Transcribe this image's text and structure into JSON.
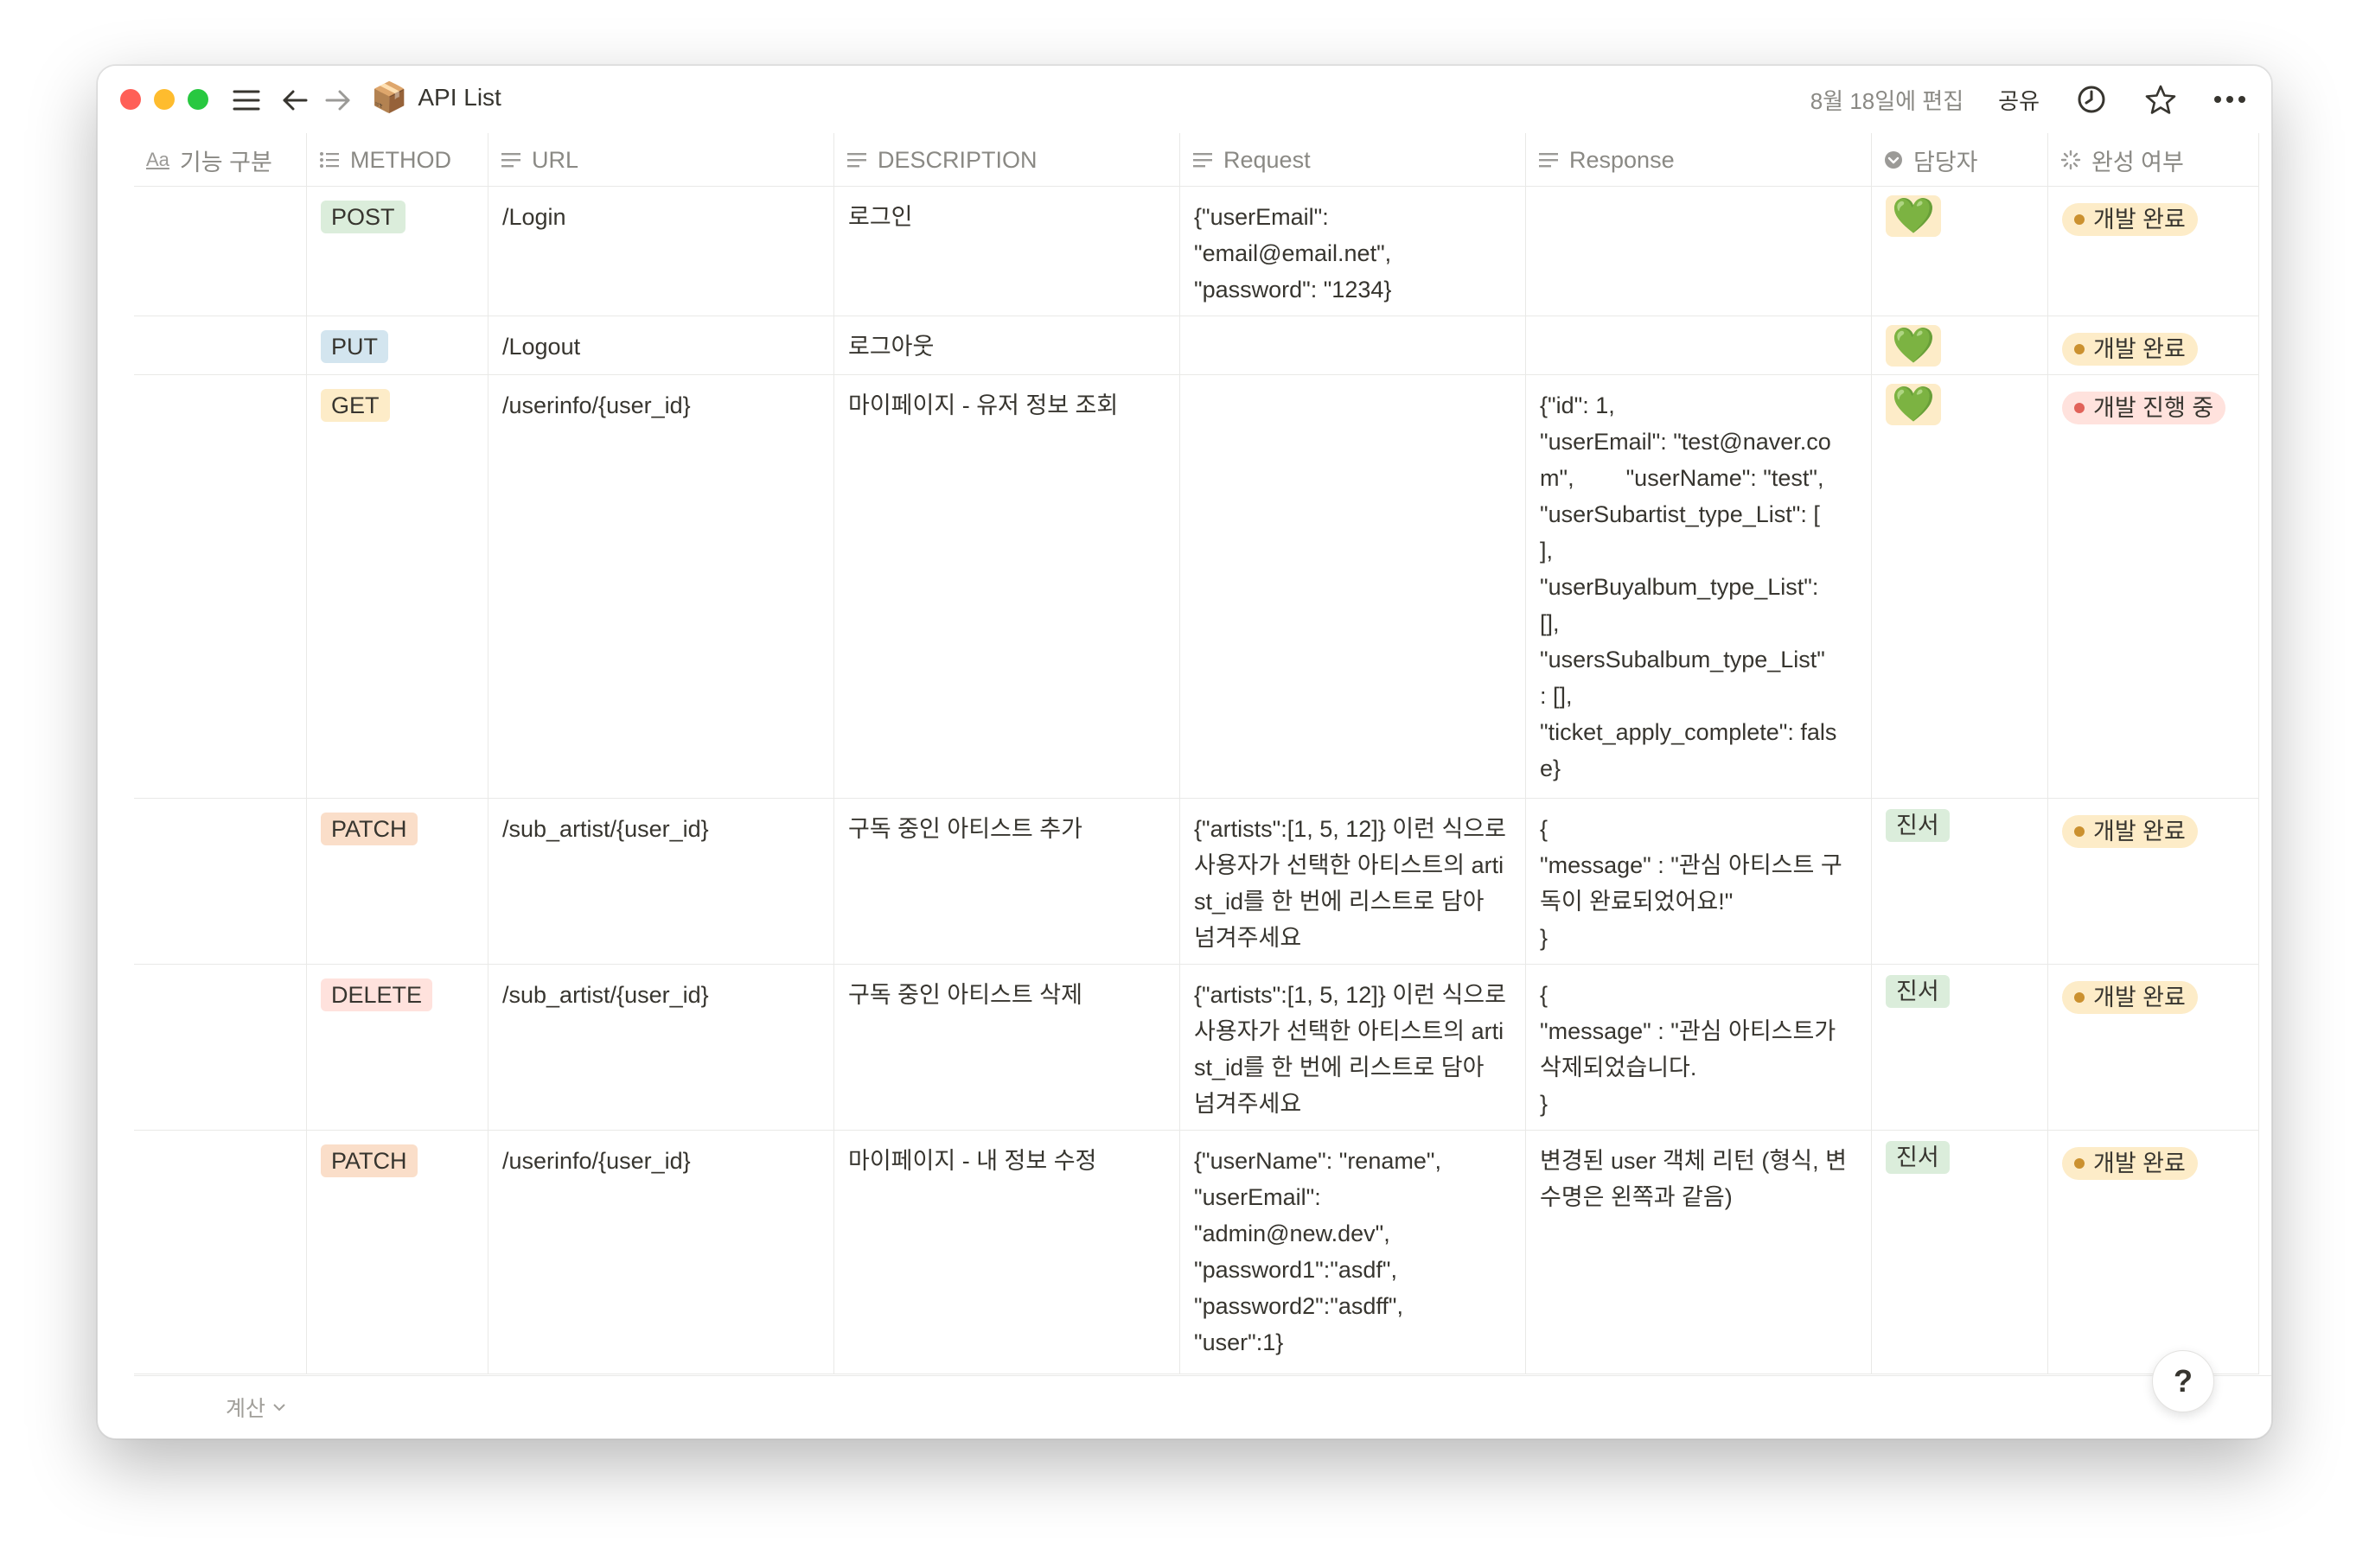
{
  "window": {
    "title": "API List",
    "edited": "8월 18일에 편집",
    "share": "공유"
  },
  "columns": [
    {
      "label": "기능 구분",
      "icon": "text-aa-icon"
    },
    {
      "label": "METHOD",
      "icon": "multi-select-icon"
    },
    {
      "label": "URL",
      "icon": "text-lines-icon"
    },
    {
      "label": "DESCRIPTION",
      "icon": "text-lines-icon"
    },
    {
      "label": "Request",
      "icon": "text-lines-icon"
    },
    {
      "label": "Response",
      "icon": "text-lines-icon"
    },
    {
      "label": "담당자",
      "icon": "select-icon"
    },
    {
      "label": "완성 여부",
      "icon": "status-icon"
    }
  ],
  "rows": [
    {
      "method": "POST",
      "url": "/Login",
      "description": "로그인",
      "request": "{\"userEmail\":\n\"email@email.net\",\n\"password\": \"1234}",
      "response": "",
      "owner_type": "heart",
      "owner": "💚",
      "status": "개발 완료"
    },
    {
      "method": "PUT",
      "url": "/Logout",
      "description": "로그아웃",
      "request": "",
      "response": "",
      "owner_type": "heart",
      "owner": "💚",
      "status": "개발 완료"
    },
    {
      "method": "GET",
      "url": "/userinfo/{user_id}",
      "description": "마이페이지 - 유저 정보 조회",
      "request": "",
      "response": "{\"id\": 1,\n\"userEmail\": \"test@naver.com\",        \"userName\": \"test\",\n\"userSubartist_type_List\": [\n],\n\"userBuyalbum_type_List\":\n[],\n\"usersSubalbum_type_List\"\n: [],\n\"ticket_apply_complete\": false}",
      "owner_type": "heart",
      "owner": "💚",
      "status": "개발 진행 중"
    },
    {
      "method": "PATCH",
      "url": "/sub_artist/{user_id}",
      "description": "구독 중인 아티스트 추가",
      "request": "{\"artists\":[1, 5, 12]} 이런 식으로 사용자가 선택한 아티스트의 artist_id를 한 번에 리스트로 담아 넘겨주세요",
      "response": "{\n\"message\" : \"관심 아티스트 구독이 완료되었어요!\"\n}",
      "owner_type": "tag",
      "owner": "진서",
      "status": "개발 완료"
    },
    {
      "method": "DELETE",
      "url": "/sub_artist/{user_id}",
      "description": "구독 중인 아티스트 삭제",
      "request": "{\"artists\":[1, 5, 12]} 이런 식으로 사용자가 선택한 아티스트의 artist_id를 한 번에 리스트로 담아 넘겨주세요",
      "response": "{\n\"message\" : \"관심 아티스트가 삭제되었습니다.\n}",
      "owner_type": "tag",
      "owner": "진서",
      "status": "개발 완료"
    },
    {
      "method": "PATCH",
      "url": "/userinfo/{user_id}",
      "description": "마이페이지 - 내 정보 수정",
      "request": "{\"userName\": \"rename\",\n\"userEmail\":\n\"admin@new.dev\",\n\"password1\":\"asdf\",\n\"password2\":\"asdff\",\n\"user\":1}",
      "response": "변경된 user 객체 리턴 (형식, 변수명은 왼쪽과 같음)",
      "owner_type": "tag",
      "owner": "진서",
      "status": "개발 완료"
    }
  ],
  "method_colors": {
    "POST": "#dbeddb",
    "PUT": "#d3e5ef",
    "GET": "#fdecc8",
    "PATCH": "#fadec9",
    "DELETE": "#ffe2dd"
  },
  "status_colors": {
    "개발 완료": {
      "bg": "#fdecc8",
      "dot": "#cb912f"
    },
    "개발 진행 중": {
      "bg": "#ffe2dd",
      "dot": "#e16259"
    }
  },
  "owner_tag_color": "#dbeddb",
  "owner_heart_bg": "#fdecc8",
  "footer": {
    "calc": "계산"
  },
  "help": "?"
}
